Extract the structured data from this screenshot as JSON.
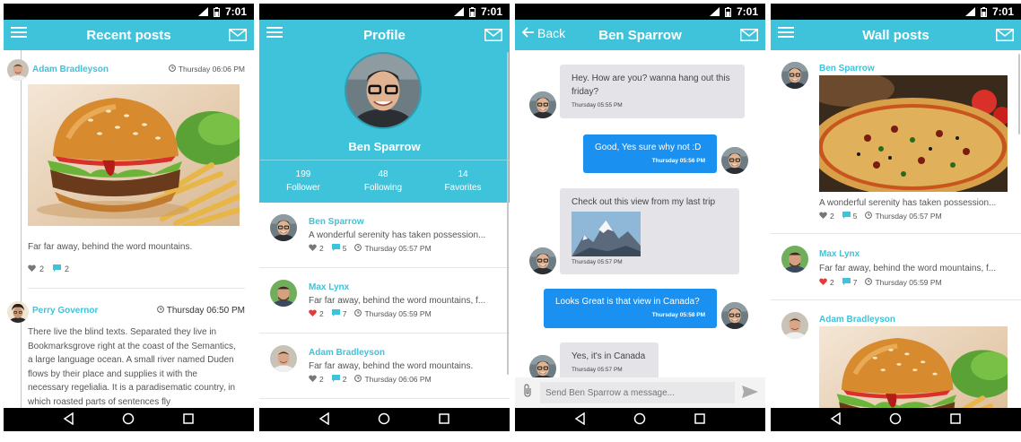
{
  "statusbar": {
    "time": "7:01"
  },
  "feed": {
    "title": "Recent posts",
    "posts": [
      {
        "author": "Adam Bradleyson",
        "time": "Thursday 06:06 PM",
        "text": "Far far away, behind the word mountains.",
        "likes": "2",
        "comments": "2"
      },
      {
        "author": "Perry Governor",
        "time": "Thursday 06:50 PM",
        "text": "There live the blind texts. Separated they live in Bookmarksgrove right at the coast of the Semantics, a large language ocean. A small river named Duden flows by their place and supplies it with the necessary regelialia. It is a paradisematic country, in which roasted parts of sentences fly"
      }
    ]
  },
  "profile": {
    "title": "Profile",
    "name": "Ben Sparrow",
    "stats": [
      {
        "value": "199",
        "label": "Follower"
      },
      {
        "value": "48",
        "label": "Following"
      },
      {
        "value": "14",
        "label": "Favorites"
      }
    ],
    "posts": [
      {
        "author": "Ben Sparrow",
        "text": "A wonderful serenity has taken possession...",
        "likes": "2",
        "comments": "5",
        "time": "Thursday 05:57 PM",
        "liked": false
      },
      {
        "author": "Max Lynx",
        "text": "Far far away, behind the word mountains, f...",
        "likes": "2",
        "comments": "7",
        "time": "Thursday 05:59 PM",
        "liked": true
      },
      {
        "author": "Adam Bradleyson",
        "text": "Far far away, behind the word mountains.",
        "likes": "2",
        "comments": "2",
        "time": "Thursday 06:06 PM",
        "liked": false
      }
    ]
  },
  "chat": {
    "back_label": "Back",
    "title": "Ben Sparrow",
    "messages": [
      {
        "text": "Hey. How are you? wanna hang out this friday?",
        "time": "Thursday 05:55 PM"
      },
      {
        "text": "Good, Yes sure why not :D",
        "time": "Thursday 05:56 PM"
      },
      {
        "text": "Check out this view from my last trip",
        "time": "Thursday 05:57 PM"
      },
      {
        "text": "Looks Great is that view in Canada?",
        "time": "Thursday 05:58 PM"
      },
      {
        "text": "Yes, it's in Canada",
        "time": "Thursday 05:57 PM"
      }
    ],
    "input_placeholder": "Send Ben Sparrow a message..."
  },
  "wall": {
    "title": "Wall posts",
    "posts": [
      {
        "author": "Ben Sparrow",
        "text": "A wonderful serenity has taken possession...",
        "likes": "2",
        "comments": "5",
        "time": "Thursday 05:57 PM"
      },
      {
        "author": "Max Lynx",
        "text": "Far far away, behind the word mountains, f...",
        "likes": "2",
        "comments": "7",
        "time": "Thursday 05:59 PM"
      },
      {
        "author": "Adam Bradleyson"
      }
    ]
  },
  "colors": {
    "accent": "#3ec3da",
    "bubble_blue": "#1a90f0",
    "like_red": "#e53935"
  }
}
